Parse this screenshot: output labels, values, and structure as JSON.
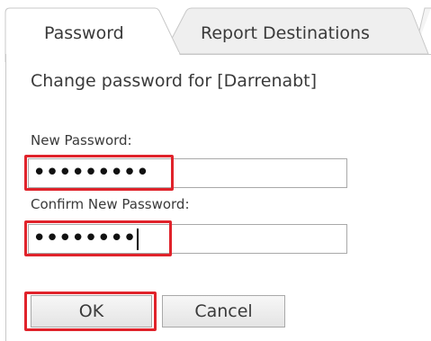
{
  "tabs": [
    {
      "label": "Password",
      "active": true
    },
    {
      "label": "Report Destinations",
      "active": false
    }
  ],
  "form": {
    "heading": "Change password for [Darrenabt]",
    "new_password_label": "New Password:",
    "new_password_value": "•••••••••",
    "confirm_password_label": "Confirm New Password:",
    "confirm_password_value": "••••••••"
  },
  "buttons": {
    "ok": "OK",
    "cancel": "Cancel"
  },
  "colors": {
    "highlight": "#e0232b",
    "border": "#a9a9a9"
  }
}
